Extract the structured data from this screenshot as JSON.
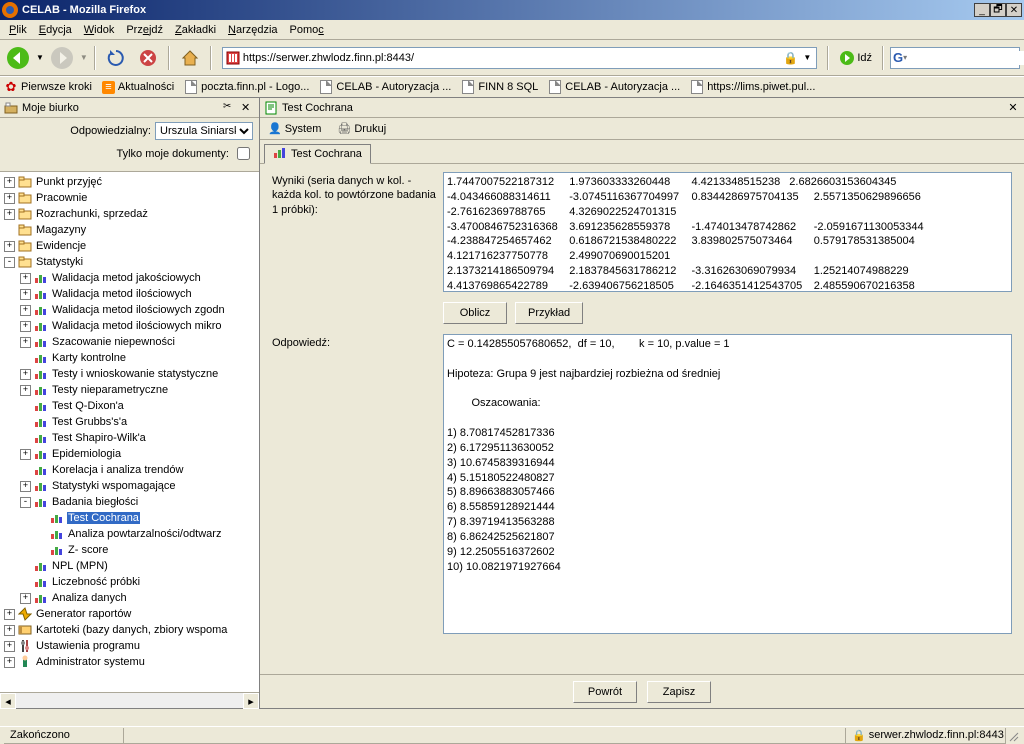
{
  "window": {
    "title": "CELAB - Mozilla Firefox"
  },
  "menus": [
    "Plik",
    "Edycja",
    "Widok",
    "Przejdź",
    "Zakładki",
    "Narzędzia",
    "Pomoc"
  ],
  "url": "https://serwer.zhwlodz.finn.pl:8443/",
  "go_label": "Idź",
  "bookmarks": [
    {
      "label": "Pierwsze kroki",
      "color": "#c00"
    },
    {
      "label": "Aktualności",
      "color": "#f80"
    },
    {
      "label": "poczta.finn.pl - Logo...",
      "color": "page"
    },
    {
      "label": "CELAB - Autoryzacja ...",
      "color": "page"
    },
    {
      "label": "FINN 8 SQL",
      "color": "page"
    },
    {
      "label": "CELAB - Autoryzacja ...",
      "color": "page"
    },
    {
      "label": "https://lims.piwet.pul...",
      "color": "page"
    }
  ],
  "sidebar": {
    "title": "Moje biurko",
    "resp_label": "Odpowiedzialny:",
    "resp_value": "Urszula Siniarska",
    "only_label": "Tylko moje dokumenty:"
  },
  "tree": [
    {
      "lvl": 0,
      "exp": "+",
      "label": "Punkt przyjęć"
    },
    {
      "lvl": 0,
      "exp": "+",
      "label": "Pracownie"
    },
    {
      "lvl": 0,
      "exp": "+",
      "label": "Rozrachunki, sprzedaż"
    },
    {
      "lvl": 0,
      "exp": "",
      "label": "Magazyny"
    },
    {
      "lvl": 0,
      "exp": "+",
      "label": "Ewidencje"
    },
    {
      "lvl": 0,
      "exp": "-",
      "label": "Statystyki"
    },
    {
      "lvl": 1,
      "exp": "+",
      "label": "Walidacja metod jakościowych"
    },
    {
      "lvl": 1,
      "exp": "+",
      "label": "Walidacja metod ilościowych"
    },
    {
      "lvl": 1,
      "exp": "+",
      "label": "Walidacja metod ilościowych zgodn"
    },
    {
      "lvl": 1,
      "exp": "+",
      "label": "Walidacja metod ilościowych mikro"
    },
    {
      "lvl": 1,
      "exp": "+",
      "label": "Szacowanie niepewności"
    },
    {
      "lvl": 1,
      "exp": "",
      "label": "Karty kontrolne"
    },
    {
      "lvl": 1,
      "exp": "+",
      "label": "Testy i wnioskowanie statystyczne"
    },
    {
      "lvl": 1,
      "exp": "+",
      "label": "Testy nieparametryczne"
    },
    {
      "lvl": 1,
      "exp": "",
      "label": "Test Q-Dixon'a"
    },
    {
      "lvl": 1,
      "exp": "",
      "label": "Test Grubbs's'a"
    },
    {
      "lvl": 1,
      "exp": "",
      "label": "Test Shapiro-Wilk'a"
    },
    {
      "lvl": 1,
      "exp": "+",
      "label": "Epidemiologia"
    },
    {
      "lvl": 1,
      "exp": "",
      "label": "Korelacja i analiza trendów"
    },
    {
      "lvl": 1,
      "exp": "+",
      "label": "Statystyki wspomagające"
    },
    {
      "lvl": 1,
      "exp": "-",
      "label": "Badania biegłości"
    },
    {
      "lvl": 2,
      "exp": "",
      "label": "Test Cochrana",
      "sel": true
    },
    {
      "lvl": 2,
      "exp": "",
      "label": "Analiza powtarzalności/odtwarz"
    },
    {
      "lvl": 2,
      "exp": "",
      "label": "Z- score"
    },
    {
      "lvl": 1,
      "exp": "",
      "label": "NPL (MPN)"
    },
    {
      "lvl": 1,
      "exp": "",
      "label": "Liczebność próbki"
    },
    {
      "lvl": 1,
      "exp": "+",
      "label": "Analiza danych"
    },
    {
      "lvl": 0,
      "exp": "+",
      "label": "Generator raportów"
    },
    {
      "lvl": 0,
      "exp": "+",
      "label": "Kartoteki (bazy danych, zbiory wspoma"
    },
    {
      "lvl": 0,
      "exp": "+",
      "label": "Ustawienia programu"
    },
    {
      "lvl": 0,
      "exp": "+",
      "label": "Administrator systemu"
    }
  ],
  "content": {
    "title": "Test Cochrana",
    "tb_system": "System",
    "tb_print": "Drukuj",
    "tab": "Test Cochrana",
    "input_label": "Wyniki (seria danych w kol. - każda kol. to powtórzone badania 1 próbki):",
    "input_text": "1.7447007522187312\t1.973603333260448\t4.4213348515238\t2.6826603153604345\n-4.043466088314611\t-3.0745116367704997\t0.8344286975704135\t2.5571350629896656\n-2.76162369788765\t4.3269022524701315\n-3.4700846752316368\t3.691235628559378\t-1.474013478742862\t-2.0591671130053344\n-4.238847254657462\t0.6186721538480222\t3.839802575073464\t0.579178531385004\n4.121716237750778\t2.499070690015201\n2.1373214186509794\t2.1837845631786212\t-3.316263069079934\t1.25214074988229\n4.413769865422789\t-2.639406756218505\t-2.1646351412543705\t2.485590670216358",
    "btn_calc": "Oblicz",
    "btn_example": "Przykład",
    "answer_label": "Odpowiedź:",
    "answer_text": "C = 0.142855057680652,  df = 10,        k = 10, p.value = 1\n\nHipoteza: Grupa 9 jest najbardziej rozbieżna od średniej\n\n        Oszacowania:\n\n1) 8.70817452817336\n2) 6.17295113630052\n3) 10.6745839316944\n4) 5.15180522480827\n5) 8.89663883057466\n6) 8.55859128921444\n7) 8.39719413563288\n8) 6.86242525621807\n9) 12.2505516372602\n10) 10.0821971927664",
    "btn_back": "Powrót",
    "btn_save": "Zapisz"
  },
  "status": {
    "left": "Zakończono",
    "right": "serwer.zhwlodz.finn.pl:8443"
  }
}
